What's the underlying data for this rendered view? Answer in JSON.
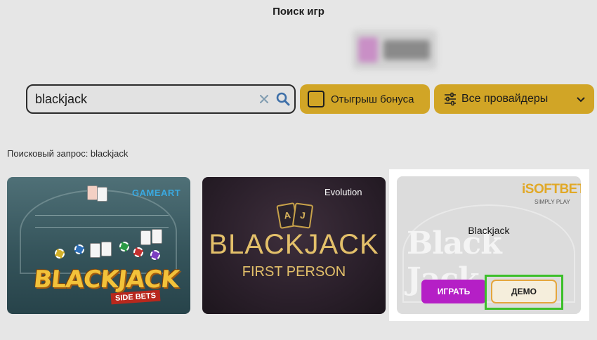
{
  "header": {
    "title": "Поиск игр"
  },
  "search": {
    "value": "blackjack",
    "clear_icon": "close-icon",
    "search_icon": "search-icon"
  },
  "filters": {
    "bonus_label": "Отыгрыш бонуса",
    "providers_label": "Все провайдеры"
  },
  "query": {
    "label": "Поисковый запрос: blackjack"
  },
  "games": [
    {
      "title_art": "BLACKJACK",
      "subtitle_art": "SIDE BETS",
      "provider_logo": "GAMEART"
    },
    {
      "title_art": "BLACKJACK",
      "subtitle_art": "FIRST PERSON",
      "provider_logo": "Evolution",
      "card_letters": [
        "A",
        "J"
      ]
    },
    {
      "name": "Blackjack",
      "provider_logo": "iSOFTBET",
      "provider_tagline": "SIMPLY PLAY",
      "background_title": "Black Jack",
      "play_label": "ИГРАТЬ",
      "demo_label": "ДЕМО"
    }
  ],
  "colors": {
    "accent_yellow": "#d1a526",
    "play_button": "#b51fc6",
    "highlight": "#3cbf2a",
    "background": "#e6e6e6"
  }
}
